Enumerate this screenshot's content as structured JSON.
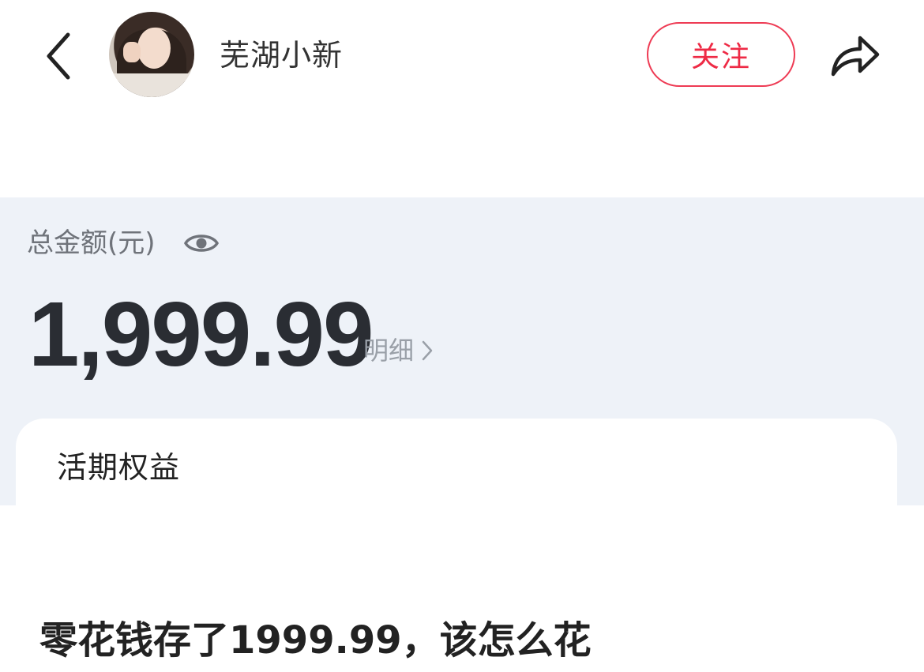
{
  "header": {
    "username": "芜湖小新",
    "follow_label": "关注"
  },
  "screenshot": {
    "total_label": "总金额(元)",
    "amount": "1,999.99",
    "detail_label": "明细",
    "card_title": "活期权益"
  },
  "post": {
    "title": "零花钱存了1999.99，该怎么花"
  },
  "colors": {
    "accent": "#ee2a45",
    "panel_bg": "#eef2f8"
  }
}
